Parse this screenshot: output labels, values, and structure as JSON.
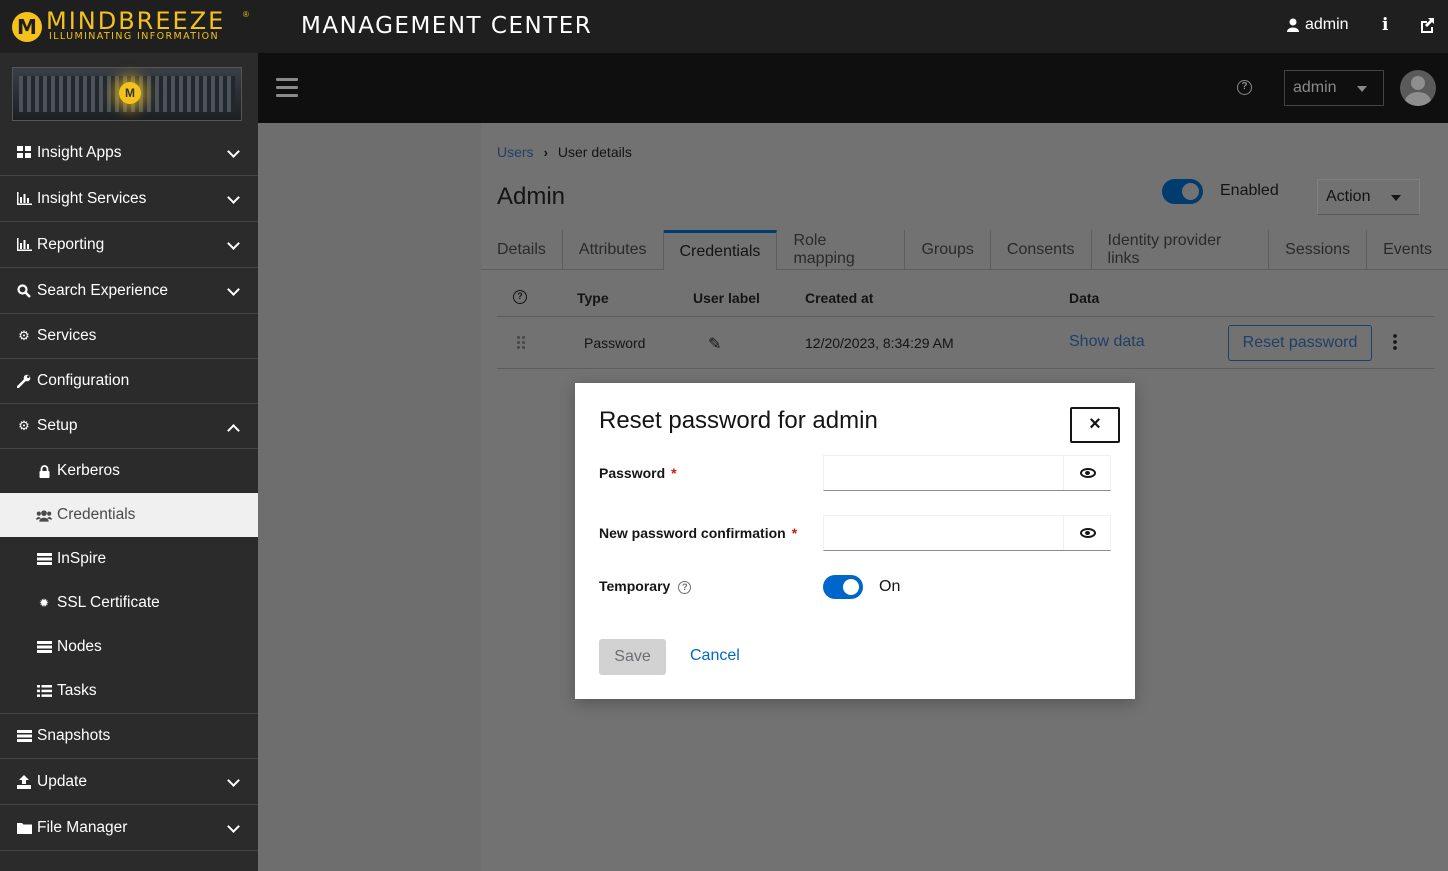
{
  "brand": {
    "name": "MINDBREEZE",
    "reg": "®",
    "tagline": "ILLUMINATING INFORMATION",
    "logo_letter": "M"
  },
  "app_title": "MANAGEMENT CENTER",
  "top": {
    "user": "admin"
  },
  "sidebar": {
    "items": [
      {
        "label": "Insight Apps",
        "icon": "grid-icon"
      },
      {
        "label": "Insight Services",
        "icon": "bar-chart-icon"
      },
      {
        "label": "Reporting",
        "icon": "bar-chart-icon"
      },
      {
        "label": "Search Experience",
        "icon": "search-icon"
      },
      {
        "label": "Services",
        "icon": "gear-icon"
      },
      {
        "label": "Configuration",
        "icon": "wrench-icon"
      },
      {
        "label": "Setup",
        "icon": "gears-icon"
      }
    ],
    "setup_children": [
      {
        "label": "Kerberos",
        "icon": "lock-icon"
      },
      {
        "label": "Credentials",
        "icon": "users-icon"
      },
      {
        "label": "InSpire",
        "icon": "server-icon"
      },
      {
        "label": "SSL Certificate",
        "icon": "certificate-icon"
      },
      {
        "label": "Nodes",
        "icon": "server-icon"
      },
      {
        "label": "Tasks",
        "icon": "list-icon"
      }
    ],
    "bottom_items": [
      {
        "label": "Snapshots",
        "icon": "server-icon"
      },
      {
        "label": "Update",
        "icon": "upload-icon"
      },
      {
        "label": "File Manager",
        "icon": "folder-icon"
      }
    ]
  },
  "subheader": {
    "user_dropdown": "admin"
  },
  "page": {
    "breadcrumb": {
      "link": "Users",
      "current": "User details"
    },
    "title": "Admin",
    "enabled_label": "Enabled",
    "action_label": "Action",
    "tabs": [
      "Details",
      "Attributes",
      "Credentials",
      "Role mapping",
      "Groups",
      "Consents",
      "Identity provider links",
      "Sessions",
      "Events"
    ],
    "active_tab": "Credentials",
    "table": {
      "headers": {
        "type": "Type",
        "user_label": "User label",
        "created_at": "Created at",
        "data": "Data"
      },
      "row": {
        "type": "Password",
        "created_at": "12/20/2023, 8:34:29 AM",
        "data_link": "Show data",
        "reset_button": "Reset password"
      }
    }
  },
  "modal": {
    "title": "Reset password for admin",
    "password_label": "Password",
    "password_value": "",
    "confirm_label": "New password confirmation",
    "confirm_value": "",
    "required_mark": "*",
    "temporary_label": "Temporary",
    "temporary_state": "On",
    "save_label": "Save",
    "cancel_label": "Cancel",
    "close_glyph": "×"
  },
  "colors": {
    "brand_yellow": "#f4c21b",
    "primary_blue": "#0066cc",
    "required_red": "#c9190b"
  }
}
